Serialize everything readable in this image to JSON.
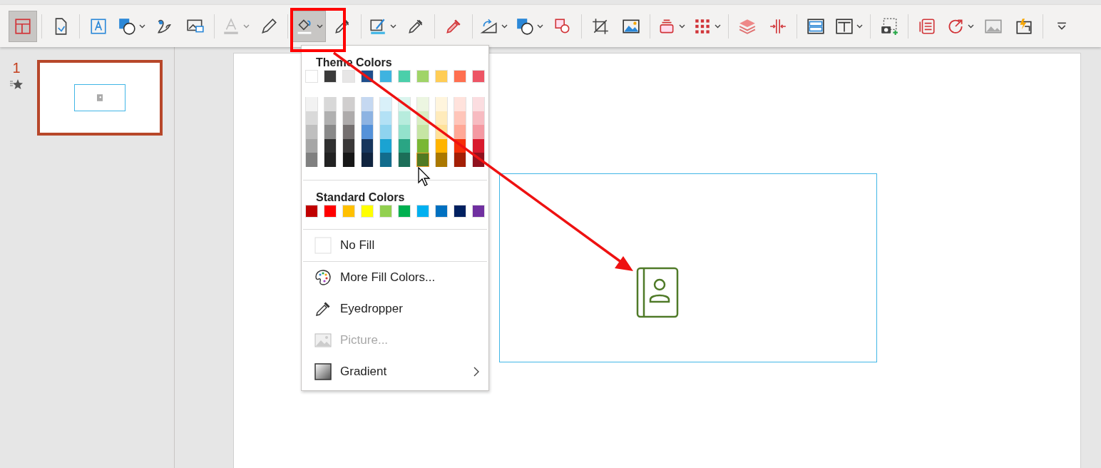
{
  "toolbar": {
    "groups": [
      [
        {
          "kind": "button",
          "pressed": true
        }
      ],
      [
        {
          "kind": "button",
          "pressed": false
        }
      ],
      [
        {
          "kind": "button",
          "pressed": false
        },
        {
          "kind": "split",
          "pressed": false
        },
        {
          "kind": "button",
          "pressed": false
        },
        {
          "kind": "button",
          "pressed": false
        }
      ],
      [
        {
          "kind": "split",
          "pressed": false,
          "disabled": true
        },
        {
          "kind": "button",
          "pressed": false
        }
      ],
      [
        {
          "kind": "split",
          "pressed": true
        },
        {
          "kind": "button",
          "pressed": false
        }
      ],
      [
        {
          "kind": "split",
          "pressed": false
        },
        {
          "kind": "button",
          "pressed": false
        }
      ],
      [
        {
          "kind": "button",
          "pressed": false
        }
      ],
      [
        {
          "kind": "split",
          "pressed": false
        },
        {
          "kind": "split",
          "pressed": false
        },
        {
          "kind": "button",
          "pressed": false
        }
      ],
      [
        {
          "kind": "button",
          "pressed": false
        },
        {
          "kind": "button",
          "pressed": false
        }
      ],
      [
        {
          "kind": "split",
          "pressed": false
        },
        {
          "kind": "split",
          "pressed": false
        }
      ],
      [
        {
          "kind": "button",
          "pressed": false
        },
        {
          "kind": "button",
          "pressed": false
        }
      ],
      [
        {
          "kind": "button",
          "pressed": false
        },
        {
          "kind": "split",
          "pressed": false
        }
      ],
      [
        {
          "kind": "button",
          "pressed": false
        }
      ],
      [
        {
          "kind": "button",
          "pressed": false
        },
        {
          "kind": "split",
          "pressed": false
        },
        {
          "kind": "button",
          "pressed": false
        },
        {
          "kind": "button",
          "pressed": false
        }
      ],
      [
        {
          "kind": "overflow",
          "pressed": false
        }
      ]
    ]
  },
  "slides_pane": {
    "slides": [
      {
        "number": "1",
        "selected": true,
        "animated": true
      }
    ]
  },
  "slide": {
    "shape": {
      "selected": true
    }
  },
  "fill_menu": {
    "theme_title": "Theme Colors",
    "theme_top": [
      {
        "color": "#ffffff"
      },
      {
        "color": "#3a3a3a"
      },
      {
        "color": "#e7e6e6"
      },
      {
        "color": "#1f4e8c"
      },
      {
        "color": "#3fb3e0"
      },
      {
        "color": "#4bcfaa"
      },
      {
        "color": "#a0d468"
      },
      {
        "color": "#ffcd55"
      },
      {
        "color": "#ff6f50"
      },
      {
        "color": "#ed5565"
      }
    ],
    "theme_shades": [
      [
        {
          "color": "#f2f2f2",
          "selected": false
        },
        {
          "color": "#d9d9d9",
          "selected": false
        },
        {
          "color": "#bfbfbf",
          "selected": false
        },
        {
          "color": "#a6a6a6",
          "selected": false
        },
        {
          "color": "#808080",
          "selected": false
        }
      ],
      [
        {
          "color": "#d8d8d8",
          "selected": false
        },
        {
          "color": "#b0b0b0",
          "selected": false
        },
        {
          "color": "#898989",
          "selected": false
        },
        {
          "color": "#303030",
          "selected": false
        },
        {
          "color": "#222222",
          "selected": false
        }
      ],
      [
        {
          "color": "#d0cece",
          "selected": false
        },
        {
          "color": "#aeabab",
          "selected": false
        },
        {
          "color": "#757070",
          "selected": false
        },
        {
          "color": "#3a3838",
          "selected": false
        },
        {
          "color": "#171717",
          "selected": false
        }
      ],
      [
        {
          "color": "#c5d8f1",
          "selected": false
        },
        {
          "color": "#8db3e2",
          "selected": false
        },
        {
          "color": "#5592d9",
          "selected": false
        },
        {
          "color": "#17365d",
          "selected": false
        },
        {
          "color": "#10243f",
          "selected": false
        }
      ],
      [
        {
          "color": "#d9f0f9",
          "selected": false
        },
        {
          "color": "#b3e1f5",
          "selected": false
        },
        {
          "color": "#8ed3ef",
          "selected": false
        },
        {
          "color": "#1ba3d2",
          "selected": false
        },
        {
          "color": "#126c8c",
          "selected": false
        }
      ],
      [
        {
          "color": "#dbf5ee",
          "selected": false
        },
        {
          "color": "#b7ecdd",
          "selected": false
        },
        {
          "color": "#93e2cc",
          "selected": false
        },
        {
          "color": "#2aa584",
          "selected": false
        },
        {
          "color": "#1c6e58",
          "selected": false
        }
      ],
      [
        {
          "color": "#ecf6e1",
          "selected": false
        },
        {
          "color": "#d9eec3",
          "selected": false
        },
        {
          "color": "#c6e5a4",
          "selected": false
        },
        {
          "color": "#7ab734",
          "selected": false
        },
        {
          "color": "#517a22",
          "selected": true
        }
      ],
      [
        {
          "color": "#fff5dd",
          "selected": false
        },
        {
          "color": "#ffebbb",
          "selected": false
        },
        {
          "color": "#ffe199",
          "selected": false
        },
        {
          "color": "#ffb400",
          "selected": false
        },
        {
          "color": "#aa7800",
          "selected": false
        }
      ],
      [
        {
          "color": "#ffe2dc",
          "selected": false
        },
        {
          "color": "#ffc5b9",
          "selected": false
        },
        {
          "color": "#ffa896",
          "selected": false
        },
        {
          "color": "#f52f09",
          "selected": false
        },
        {
          "color": "#a31f06",
          "selected": false
        }
      ],
      [
        {
          "color": "#fbdde0",
          "selected": false
        },
        {
          "color": "#f7bbc1",
          "selected": false
        },
        {
          "color": "#f499a2",
          "selected": false
        },
        {
          "color": "#d81a2d",
          "selected": false
        },
        {
          "color": "#90111e",
          "selected": false
        }
      ]
    ],
    "standard_title": "Standard Colors",
    "standard": [
      {
        "color": "#c00000"
      },
      {
        "color": "#ff0000"
      },
      {
        "color": "#ffc000"
      },
      {
        "color": "#ffff00"
      },
      {
        "color": "#92d050"
      },
      {
        "color": "#00b050"
      },
      {
        "color": "#00b0f0"
      },
      {
        "color": "#0070c0"
      },
      {
        "color": "#002060"
      },
      {
        "color": "#7030a0"
      }
    ],
    "items": [
      {
        "kind": "no_fill",
        "label": "No Fill",
        "disabled": false
      },
      {
        "kind": "more_colors",
        "label": "More Fill Colors...",
        "disabled": false
      },
      {
        "kind": "eyedropper",
        "label": "Eyedropper",
        "disabled": false
      },
      {
        "kind": "picture",
        "label": "Picture...",
        "disabled": true
      },
      {
        "kind": "gradient",
        "label": "Gradient",
        "disabled": false,
        "submenu": true
      }
    ]
  },
  "annotations": {
    "highlight_box": true,
    "arrow": true
  }
}
